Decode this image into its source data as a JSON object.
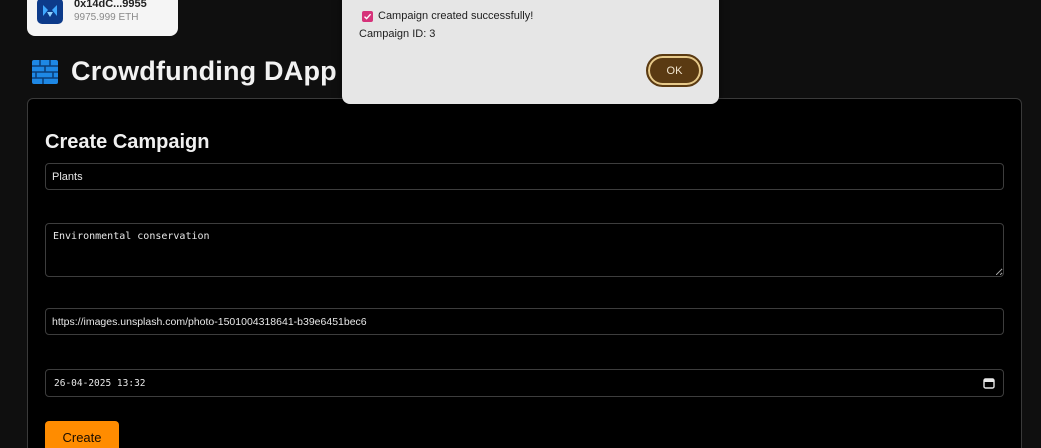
{
  "wallet": {
    "address": "0x14dC...9955",
    "balance": "9975.999 ETH",
    "icon": "wallet-icon"
  },
  "app": {
    "title": "Crowdfunding DApp",
    "icon": "brick-wall-icon"
  },
  "form": {
    "heading": "Create Campaign",
    "name_value": "Plants",
    "description_value": "Environmental conservation",
    "image_url_value": "https://images.unsplash.com/photo-1501004318641-b39e6451bec6",
    "deadline_value": "26-04-2025 13:32",
    "create_label": "Create"
  },
  "dialog": {
    "message": "Campaign created successfully!",
    "campaign_id": "Campaign ID: 3",
    "ok_label": "OK"
  },
  "colors": {
    "accent": "#ff8c00",
    "background": "#0f0f0f",
    "dialog_button": "#5a3a12",
    "check": "#d6337a"
  }
}
